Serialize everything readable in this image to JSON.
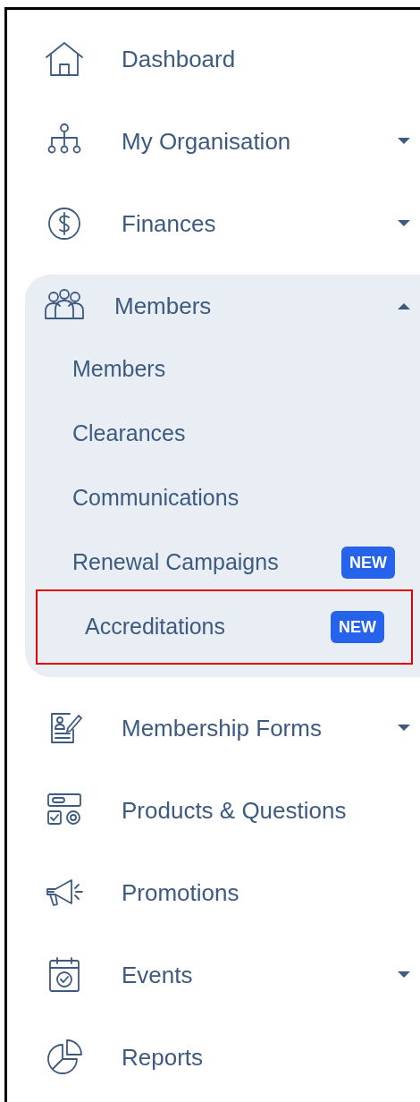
{
  "nav": [
    {
      "label": "Dashboard"
    },
    {
      "label": "My Organisation",
      "expanded": false
    },
    {
      "label": "Finances",
      "expanded": false
    },
    {
      "label": "Members",
      "expanded": true,
      "children": [
        {
          "label": "Members"
        },
        {
          "label": "Clearances"
        },
        {
          "label": "Communications"
        },
        {
          "label": "Renewal Campaigns",
          "badge": "NEW",
          "highlighted": false
        },
        {
          "label": "Accreditations",
          "badge": "NEW",
          "highlighted": true
        }
      ]
    },
    {
      "label": "Membership Forms",
      "expanded": false
    },
    {
      "label": "Products & Questions"
    },
    {
      "label": "Promotions"
    },
    {
      "label": "Events",
      "expanded": false
    },
    {
      "label": "Reports"
    }
  ]
}
